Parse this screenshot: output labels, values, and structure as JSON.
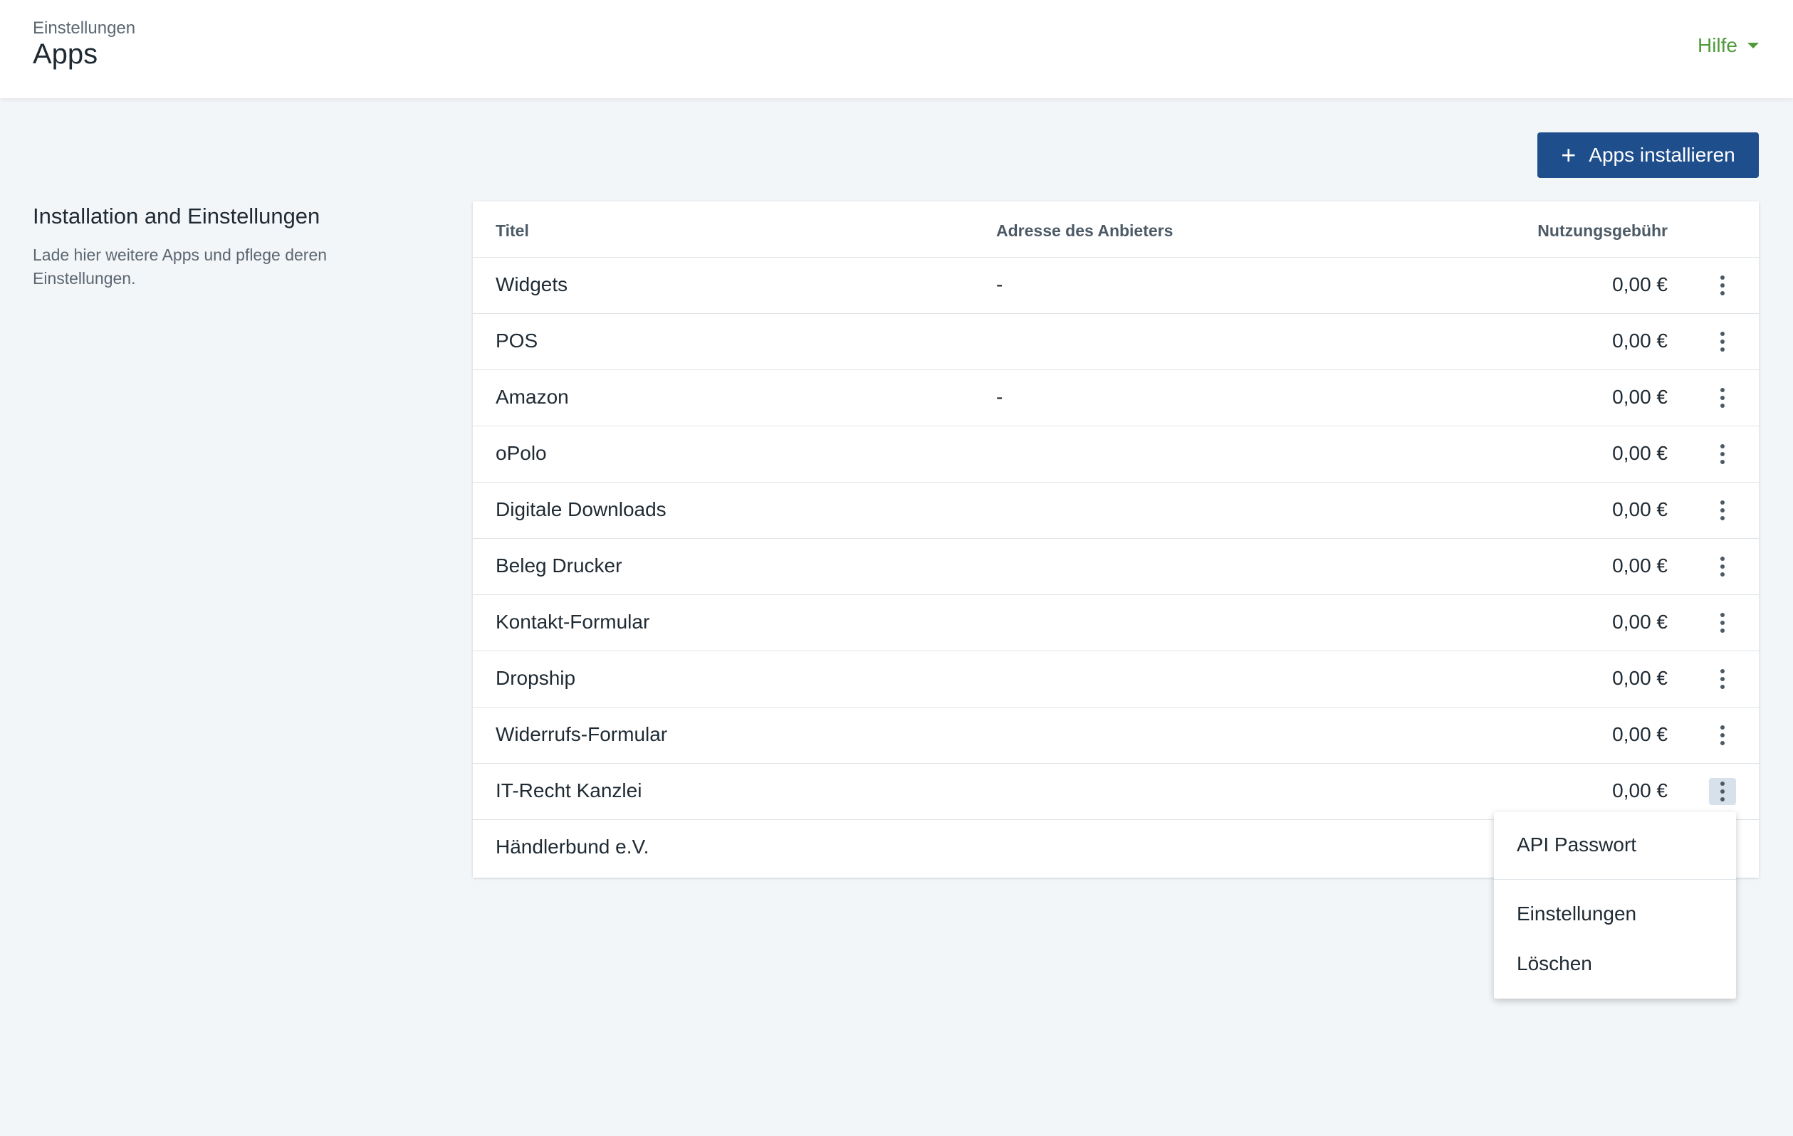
{
  "header": {
    "breadcrumb": "Einstellungen",
    "title": "Apps",
    "help_label": "Hilfe"
  },
  "actions": {
    "install_label": "Apps installieren",
    "install_icon": "plus-icon"
  },
  "section": {
    "title": "Installation and Einstellungen",
    "description": "Lade hier weitere Apps und pflege deren Einstellungen."
  },
  "table": {
    "columns": {
      "title": "Titel",
      "address": "Adresse des Anbieters",
      "fee": "Nutzungsgebühr"
    },
    "rows": [
      {
        "title": "Widgets",
        "address": "-",
        "fee": "0,00 €"
      },
      {
        "title": "POS",
        "address": "",
        "fee": "0,00 €"
      },
      {
        "title": "Amazon",
        "address": "-",
        "fee": "0,00 €"
      },
      {
        "title": "oPolo",
        "address": "",
        "fee": "0,00 €"
      },
      {
        "title": "Digitale Downloads",
        "address": "",
        "fee": "0,00 €"
      },
      {
        "title": "Beleg Drucker",
        "address": "",
        "fee": "0,00 €"
      },
      {
        "title": "Kontakt-Formular",
        "address": "",
        "fee": "0,00 €"
      },
      {
        "title": "Dropship",
        "address": "",
        "fee": "0,00 €"
      },
      {
        "title": "Widerrufs-Formular",
        "address": "",
        "fee": "0,00 €"
      },
      {
        "title": "IT-Recht Kanzlei",
        "address": "",
        "fee": "0,00 €"
      },
      {
        "title": "Händlerbund e.V.",
        "address": "",
        "fee": ""
      }
    ]
  },
  "menu": {
    "items": [
      "API Passwort",
      "Einstellungen",
      "Löschen"
    ]
  },
  "colors": {
    "primary": "#1f4e8c",
    "help": "#4f9a3a",
    "background": "#f3f6f9"
  }
}
